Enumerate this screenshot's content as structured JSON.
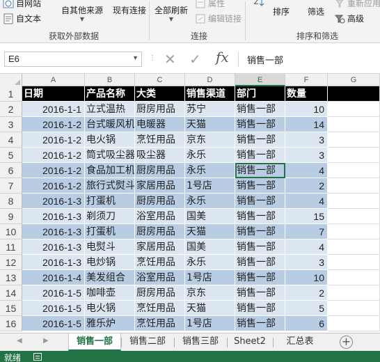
{
  "ribbon": {
    "get_data_group": {
      "label": "获取外部数据",
      "from_web": "自网站",
      "from_text": "自文本",
      "from_other": "自其他来源",
      "existing_connections": "现有连接"
    },
    "connections_group": {
      "label": "连接",
      "refresh_all": "全部刷新",
      "properties": "属性",
      "edit_links": "编辑链接"
    },
    "sort_filter_group": {
      "label": "排序和筛选",
      "sort": "排序",
      "filter": "筛选",
      "reapply": "重新应用",
      "advanced": "高级"
    }
  },
  "formula_bar": {
    "name_box": "E6",
    "fx_label": "fx",
    "formula": "销售一部"
  },
  "columns": [
    "A",
    "B",
    "C",
    "D",
    "E",
    "F",
    "G"
  ],
  "selected_column": "E",
  "selected_cell": "E6",
  "header": {
    "row_number": "1",
    "cells": [
      "日期",
      "产品名称",
      "大类",
      "销售渠道",
      "部门",
      "数量"
    ]
  },
  "rows": [
    {
      "num": "2",
      "band": "a",
      "date": "2016-1-1",
      "product": "立式温热",
      "category": "厨房用品",
      "channel": "苏宁",
      "dept": "销售一部",
      "qty": "10"
    },
    {
      "num": "3",
      "band": "b",
      "date": "2016-1-2",
      "product": "台式暖风机",
      "category": "电暖器",
      "channel": "天猫",
      "dept": "销售一部",
      "qty": "14"
    },
    {
      "num": "4",
      "band": "a",
      "date": "2016-1-2",
      "product": "电火锅",
      "category": "烹饪用品",
      "channel": "京东",
      "dept": "销售一部",
      "qty": "3"
    },
    {
      "num": "5",
      "band": "a",
      "date": "2016-1-2",
      "product": "筒式吸尘器",
      "category": "吸尘器",
      "channel": "永乐",
      "dept": "销售一部",
      "qty": "3"
    },
    {
      "num": "6",
      "band": "b",
      "date": "2016-1-2",
      "product": "食品加工机",
      "category": "厨房用品",
      "channel": "永乐",
      "dept": "销售一部",
      "qty": "4"
    },
    {
      "num": "7",
      "band": "b",
      "date": "2016-1-2",
      "product": "旅行式熨斗",
      "category": "家居用品",
      "channel": "1号店",
      "dept": "销售一部",
      "qty": "2"
    },
    {
      "num": "8",
      "band": "b",
      "date": "2016-1-3",
      "product": "打蛋机",
      "category": "厨房用品",
      "channel": "永乐",
      "dept": "销售一部",
      "qty": "4"
    },
    {
      "num": "9",
      "band": "a",
      "date": "2016-1-3",
      "product": "剃须刀",
      "category": "浴室用品",
      "channel": "国美",
      "dept": "销售一部",
      "qty": "15"
    },
    {
      "num": "10",
      "band": "b",
      "date": "2016-1-3",
      "product": "打蛋机",
      "category": "厨房用品",
      "channel": "天猫",
      "dept": "销售一部",
      "qty": "7"
    },
    {
      "num": "11",
      "band": "a",
      "date": "2016-1-3",
      "product": "电熨斗",
      "category": "家居用品",
      "channel": "国美",
      "dept": "销售一部",
      "qty": "4"
    },
    {
      "num": "12",
      "band": "a",
      "date": "2016-1-3",
      "product": "电炒锅",
      "category": "烹饪用品",
      "channel": "永乐",
      "dept": "销售一部",
      "qty": "3"
    },
    {
      "num": "13",
      "band": "b",
      "date": "2016-1-4",
      "product": "美发组合",
      "category": "浴室用品",
      "channel": "1号店",
      "dept": "销售一部",
      "qty": "10"
    },
    {
      "num": "14",
      "band": "a",
      "date": "2016-1-5",
      "product": "咖啡壶",
      "category": "厨房用品",
      "channel": "京东",
      "dept": "销售一部",
      "qty": "2"
    },
    {
      "num": "15",
      "band": "a",
      "date": "2016-1-5",
      "product": "电火锅",
      "category": "烹饪用品",
      "channel": "天猫",
      "dept": "销售一部",
      "qty": "5"
    },
    {
      "num": "16",
      "band": "b",
      "date": "2016-1-5",
      "product": "雅乐炉",
      "category": "烹饪用品",
      "channel": "1号店",
      "dept": "销售一部",
      "qty": "6"
    }
  ],
  "sheet_tabs": [
    "销售一部",
    "销售二部",
    "销售三部",
    "Sheet2",
    "汇总表"
  ],
  "active_tab": "销售一部",
  "status": {
    "text": "就绪"
  },
  "colors": {
    "accent": "#217346",
    "band_light": "#dce6f1",
    "band_dark": "#b8cce4",
    "header_fill": "#000000"
  }
}
